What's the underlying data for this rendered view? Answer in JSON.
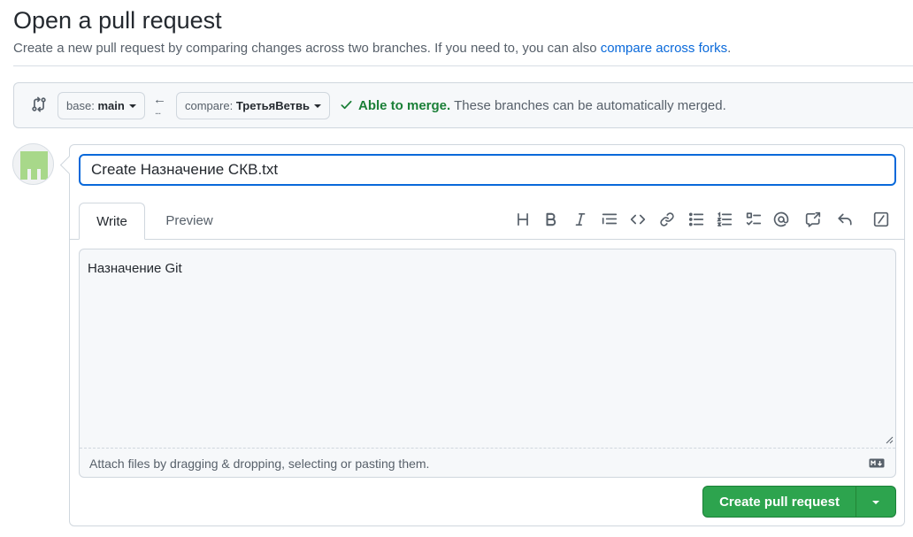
{
  "header": {
    "title": "Open a pull request",
    "subtitle": "Create a new pull request by comparing changes across two branches. If you need to, you can also",
    "forks_link": "compare across forks",
    "forks_suffix": "."
  },
  "range": {
    "base_prefix": "base:",
    "base_branch": "main",
    "compare_prefix": "compare:",
    "compare_branch": "ТретьяВетвь",
    "dots": "...",
    "merge_ok": "Able to merge.",
    "merge_msg": "These branches can be automatically merged."
  },
  "form": {
    "title_value": "Create Назначение СКВ.txt",
    "tabs": {
      "write": "Write",
      "preview": "Preview"
    },
    "body_text": "Назначение Git",
    "attach_hint": "Attach files by dragging & dropping, selecting or pasting them.",
    "submit_label": "Create pull request"
  },
  "toolbar_icons": [
    "heading-icon",
    "bold-icon",
    "italic-icon",
    "quote-icon",
    "code-icon",
    "link-icon",
    "unordered-list-icon",
    "ordered-list-icon",
    "task-list-icon",
    "mention-icon",
    "cross-reference-icon",
    "reply-icon",
    "slash-command-icon"
  ],
  "colors": {
    "accent": "#0969da",
    "success": "#1a7f37",
    "primary_button": "#2da44e",
    "avatar": "#a8d88a"
  }
}
